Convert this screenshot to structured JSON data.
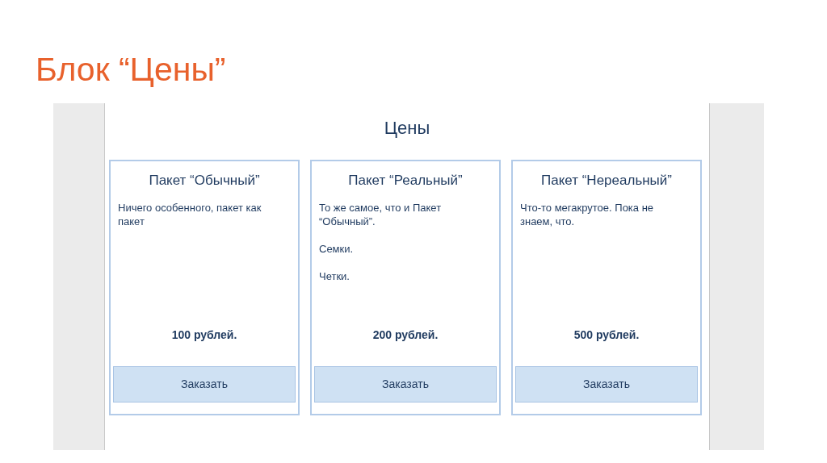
{
  "slide_title": "Блок “Цены”",
  "section_title": "Цены",
  "plans": [
    {
      "title": "Пакет “Обычный”",
      "description": [
        "Ничего особенного, пакет как пакет"
      ],
      "price": "100 рублей.",
      "button": "Заказать"
    },
    {
      "title": "Пакет “Реальный”",
      "description": [
        "То же самое, что и Пакет “Обычный”.",
        "Семки.",
        "Четки."
      ],
      "price": "200 рублей.",
      "button": "Заказать"
    },
    {
      "title": "Пакет “Нереальный”",
      "description": [
        "Что-то мегакрутое. Пока не знаем, что."
      ],
      "price": "500 рублей.",
      "button": "Заказать"
    }
  ]
}
